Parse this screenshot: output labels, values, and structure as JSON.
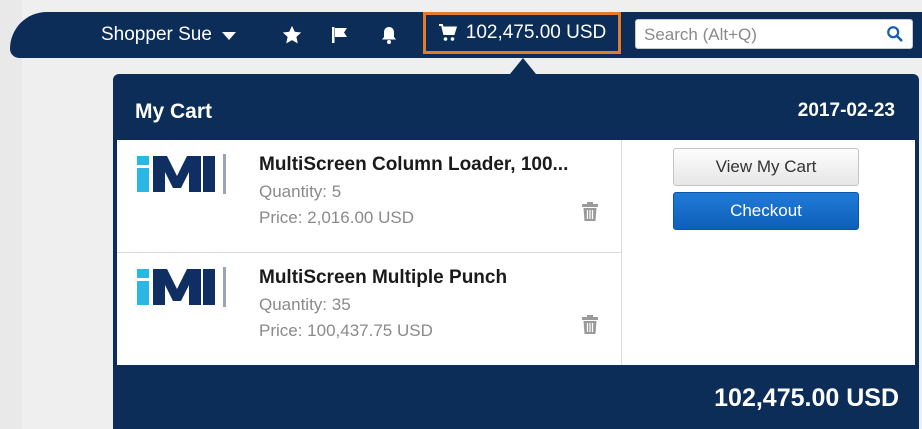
{
  "header": {
    "user_name": "Shopper Sue",
    "cart_total": "102,475.00 USD",
    "search_placeholder": "Search (Alt+Q)"
  },
  "cart": {
    "title": "My Cart",
    "date": "2017-02-23",
    "items": [
      {
        "name": "MultiScreen Column Loader, 100...",
        "quantity": "Quantity: 5",
        "price": "Price: 2,016.00 USD"
      },
      {
        "name": "MultiScreen Multiple Punch",
        "quantity": "Quantity: 35",
        "price": "Price: 100,437.75 USD"
      }
    ],
    "view_cart_label": "View My Cart",
    "checkout_label": "Checkout",
    "total": "102,475.00 USD"
  },
  "colors": {
    "navy": "#0b2d57",
    "highlight_border": "#e07c2a",
    "checkout_blue": "#1670cc",
    "logo_cyan": "#2bb7e6",
    "logo_navy": "#0f2f63"
  },
  "icons": {
    "user_caret": "caret-down-icon",
    "favorites": "star-icon",
    "flag": "flag-icon",
    "notifications": "bell-icon",
    "cart": "cart-icon",
    "search": "search-icon",
    "delete": "trash-icon"
  }
}
